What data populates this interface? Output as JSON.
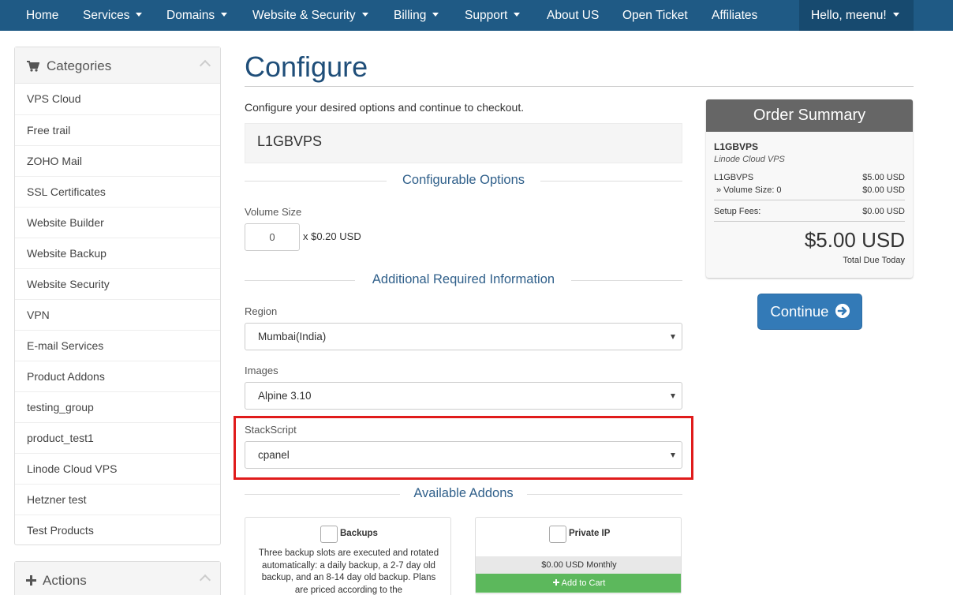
{
  "nav": {
    "home": "Home",
    "services": "Services",
    "domains": "Domains",
    "website_security": "Website & Security",
    "billing": "Billing",
    "support": "Support",
    "about": "About US",
    "open_ticket": "Open Ticket",
    "affiliates": "Affiliates",
    "user": "Hello, meenu!"
  },
  "sidebar": {
    "categories_title": "Categories",
    "items": [
      "VPS Cloud",
      "Free trail",
      "ZOHO Mail",
      "SSL Certificates",
      "Website Builder",
      "Website Backup",
      "Website Security",
      "VPN",
      "E-mail Services",
      "Product Addons",
      "testing_group",
      "product_test1",
      "Linode Cloud VPS",
      "Hetzner test",
      "Test Products"
    ],
    "actions_title": "Actions"
  },
  "main": {
    "title": "Configure",
    "intro": "Configure your desired options and continue to checkout.",
    "product_name": "L1GBVPS",
    "configurable_options": "Configurable Options",
    "volume_label": "Volume Size",
    "volume_value": "0",
    "volume_unit": "x $0.20 USD",
    "additional_info": "Additional Required Information",
    "region_label": "Region",
    "region_value": "Mumbai(India)",
    "images_label": "Images",
    "images_value": "Alpine 3.10",
    "stackscript_label": "StackScript",
    "stackscript_value": "cpanel",
    "available_addons": "Available Addons"
  },
  "addons": {
    "backups": {
      "name": "Backups",
      "description": "Three backup slots are executed and rotated automatically: a daily backup, a 2-7 day old backup, and an 8-14 day old backup. Plans are priced according to the"
    },
    "private_ip": {
      "name": "Private IP",
      "price": "$0.00 USD Monthly",
      "add_to_cart": "Add to Cart"
    }
  },
  "summary": {
    "title": "Order Summary",
    "product": "L1GBVPS",
    "group": "Linode Cloud VPS",
    "line1_label": "L1GBVPS",
    "line1_value": "$5.00 USD",
    "line2_label": "» Volume Size: 0",
    "line2_value": "$0.00 USD",
    "setup_label": "Setup Fees:",
    "setup_value": "$0.00 USD",
    "total": "$5.00 USD",
    "total_label": "Total Due Today"
  },
  "continue_label": "Continue",
  "colors": {
    "nav_bg": "#1f5a85",
    "accent": "#337ab7",
    "highlight": "#e01b1b",
    "add_to_cart": "#5cb85c"
  }
}
